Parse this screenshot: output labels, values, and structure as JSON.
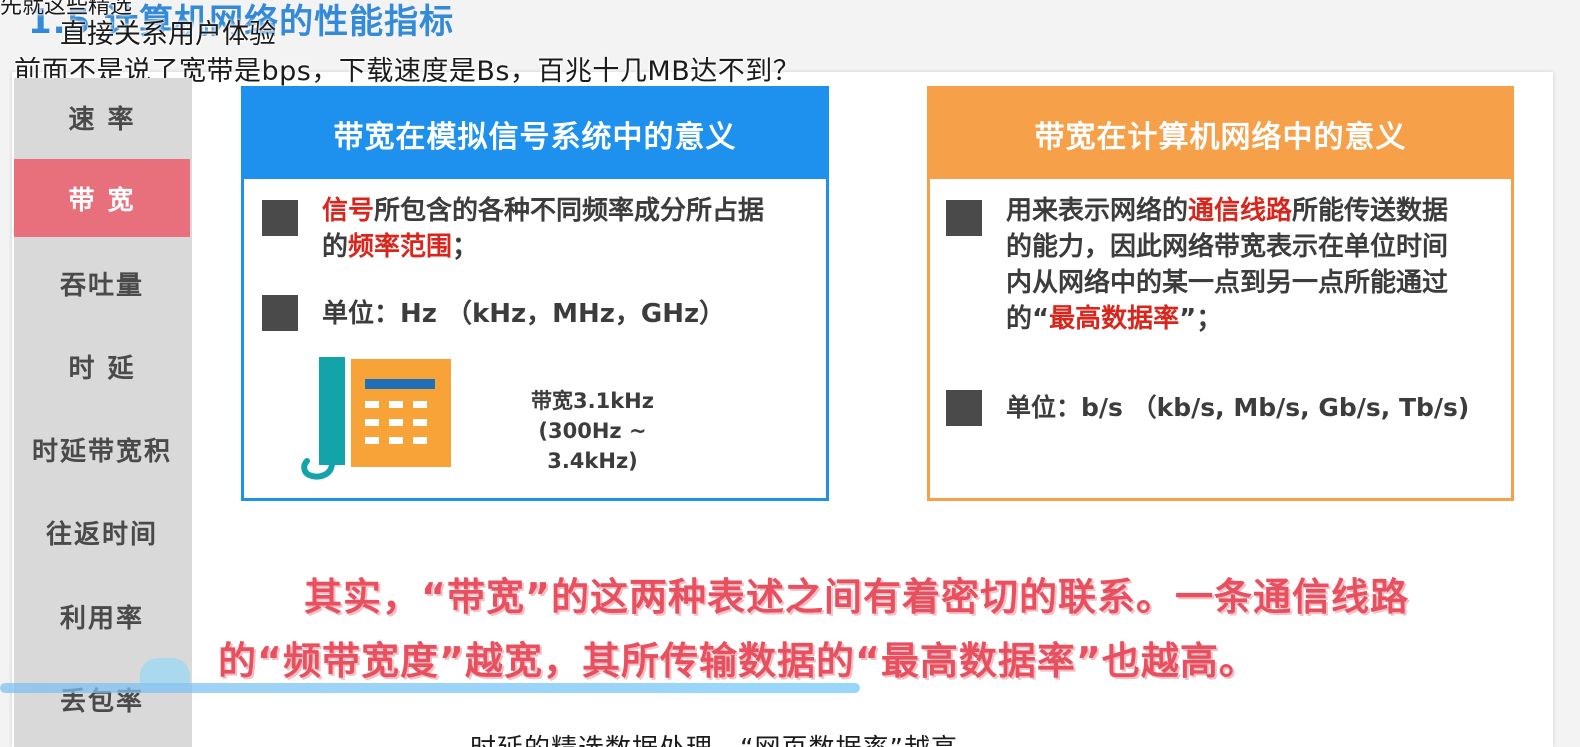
{
  "header": {
    "top_partial": "先就这些精选",
    "section_title": "1.5 计算机网络的性能指标",
    "subtitle_line1": "直接关系用户体验",
    "subtitle_line2": "前面不是说了宽带是bps，下载速度是Bs，百兆十几MB达不到？"
  },
  "sidebar": {
    "items": [
      {
        "label": "速 率"
      },
      {
        "label": "带 宽"
      },
      {
        "label": "吞吐量"
      },
      {
        "label": "时 延"
      },
      {
        "label": "时延带宽积"
      },
      {
        "label": "往返时间"
      },
      {
        "label": "利用率"
      },
      {
        "label": "丢包率"
      }
    ],
    "active_index": 1
  },
  "analog_card": {
    "title": "带宽在模拟信号系统中的意义",
    "b1_hl1": "信号",
    "b1_t1": "所包含的各种不同频率成分所占据",
    "b1_t2": "的",
    "b1_hl2": "频率范围",
    "b1_t3": "；",
    "b2": "单位：Hz （kHz，MHz，GHz）",
    "phone_caption1": "带宽3.1kHz",
    "phone_caption2": "(300Hz ~ 3.4kHz)"
  },
  "network_card": {
    "title": "带宽在计算机网络中的意义",
    "b1_t1": "用来表示网络的",
    "b1_hl1": "通信线路",
    "b1_t2": "所能传送数据",
    "b1_l2": "的能力，因此网络带宽表示在单位时间",
    "b1_l3": "内从网络中的某一点到另一点所能通过",
    "b1_l4a": "的“",
    "b1_hl2": "最高数据率",
    "b1_l4b": "”；",
    "b2": "单位：b/s （kb/s, Mb/s, Gb/s, Tb/s)"
  },
  "conclusion": {
    "line1": "其实，“带宽”的这两种表述之间有着密切的联系。一条通信线路",
    "line2": "的“频带宽度”越宽，其所传输数据的“最高数据率”也越高。"
  },
  "bottom_partial": "时延的精选数据处理，“网页数据率”越高",
  "colors": {
    "blue": "#1e90ee",
    "orange": "#f7a04a",
    "active_side": "#e8707d",
    "highlight_red": "#d9261c",
    "conclusion_red": "#e8505f"
  }
}
